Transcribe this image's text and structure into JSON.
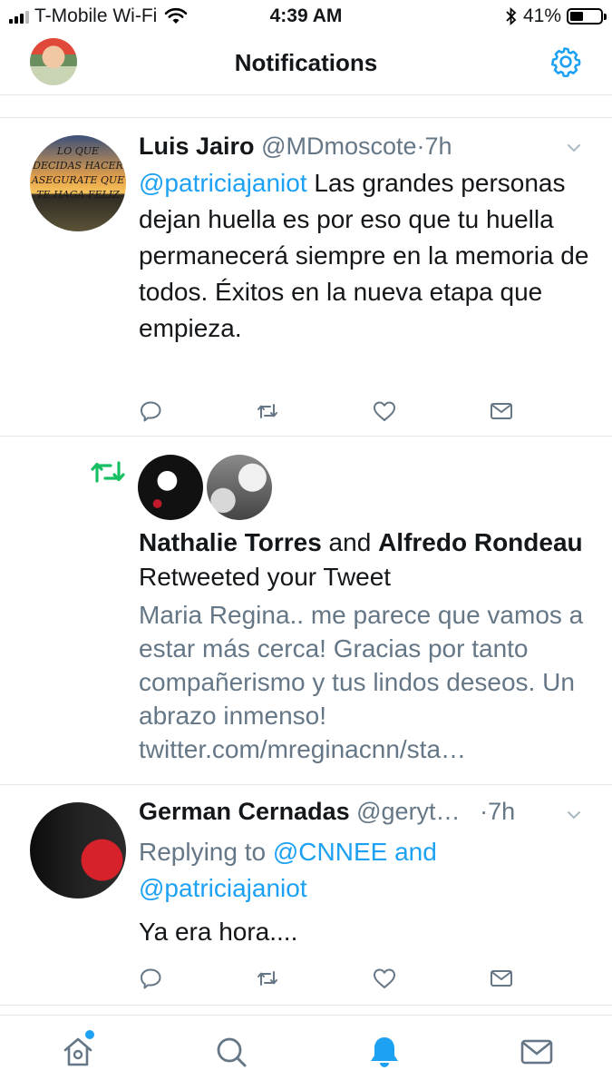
{
  "status": {
    "carrier": "T-Mobile Wi-Fi",
    "time": "4:39 AM",
    "battery": "41%"
  },
  "header": {
    "title": "Notifications"
  },
  "notifications": [
    {
      "type": "reply",
      "author": "Luis Jairo",
      "handle": "@MDmoscote",
      "sep": "·",
      "time": "7h",
      "mention": "@patriciajaniot",
      "body": " Las grandes personas dejan huella es por eso que tu huella permanecerá siempre en la memoria de todos. Éxitos en la nueva etapa que empieza."
    },
    {
      "type": "retweet",
      "name1": "Nathalie Torres",
      "conj": " and ",
      "name2": "Alfredo Rondeau",
      "action": " Retweeted your Tweet",
      "quote": "Maria Regina.. me parece que vamos a estar más cerca! Gracias por tanto compañerismo y tus lindos deseos. Un abrazo inmenso! twitter.com/mreginacnn/sta…"
    },
    {
      "type": "reply",
      "author": "German Cernadas",
      "handle": "@geryt…",
      "sep": "·",
      "time": "7h",
      "replying_prefix": "Replying to ",
      "replying_to": "@CNNEE and @patriciajaniot",
      "body": "Ya era hora...."
    }
  ],
  "icons": {
    "actions": [
      "reply-icon",
      "retweet-icon",
      "like-icon",
      "dm-icon"
    ],
    "tabs": [
      "home-icon",
      "search-icon",
      "notifications-icon",
      "messages-icon"
    ]
  },
  "colors": {
    "accent": "#1da1f2",
    "retweet": "#17bf63",
    "muted": "#657786"
  }
}
